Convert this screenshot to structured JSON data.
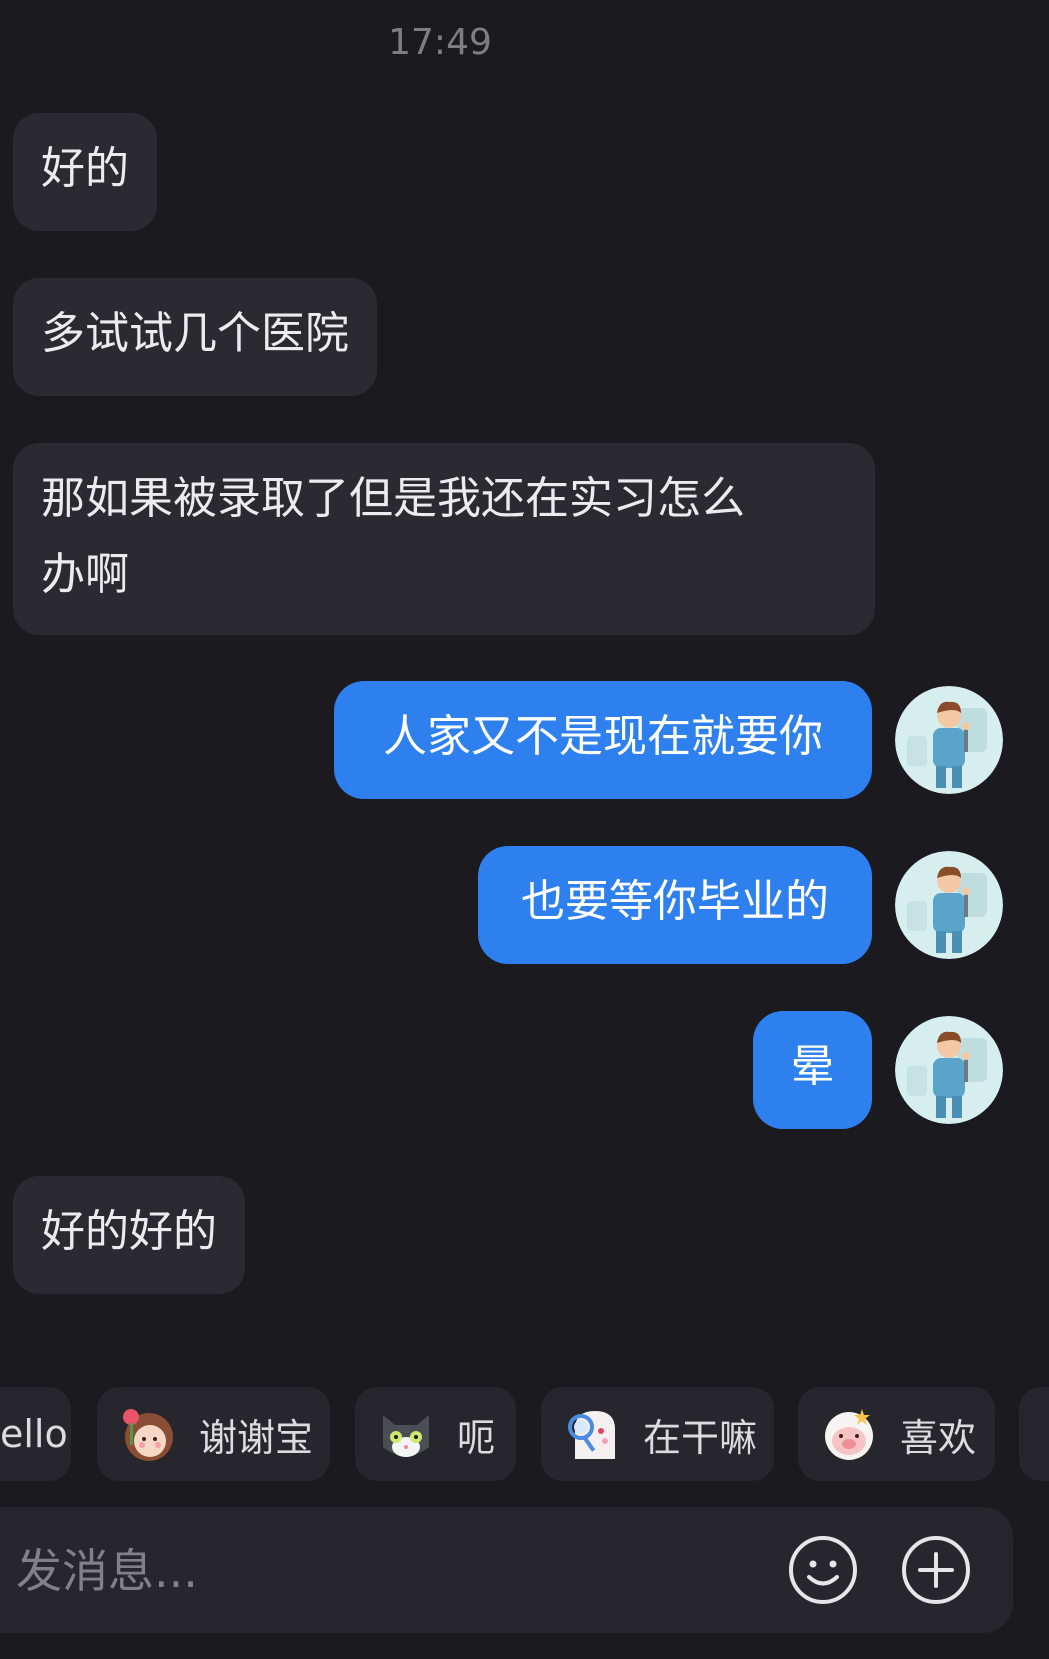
{
  "chat": {
    "timestamp": "17:49",
    "messages": [
      {
        "direction": "incoming",
        "text": "好的"
      },
      {
        "direction": "incoming",
        "text": "多试试几个医院"
      },
      {
        "direction": "incoming",
        "text_line1": "那如果被录取了但是我还在实习怎么",
        "text_line2": "办啊"
      },
      {
        "direction": "outgoing",
        "text": "人家又不是现在就要你"
      },
      {
        "direction": "outgoing",
        "text": "也要等你毕业的"
      },
      {
        "direction": "outgoing",
        "text": "晕"
      },
      {
        "direction": "incoming",
        "text": "好的好的"
      }
    ]
  },
  "quick_replies": [
    {
      "label": "ello"
    },
    {
      "label": "谢谢宝",
      "icon": "girl-flower-sticker-icon"
    },
    {
      "label": "呃",
      "icon": "gray-cat-sticker-icon"
    },
    {
      "label": "在干嘛",
      "icon": "magnifier-ghost-sticker-icon"
    },
    {
      "label": "喜欢",
      "icon": "pink-pig-sticker-icon"
    }
  ],
  "composer": {
    "placeholder": "发消息...",
    "emoji_icon": "smiley-icon",
    "plus_icon": "plus-circle-icon"
  },
  "colors": {
    "background": "#1a1a1f",
    "incoming_bubble": "#2a2a30",
    "outgoing_bubble": "#2f80ef"
  }
}
